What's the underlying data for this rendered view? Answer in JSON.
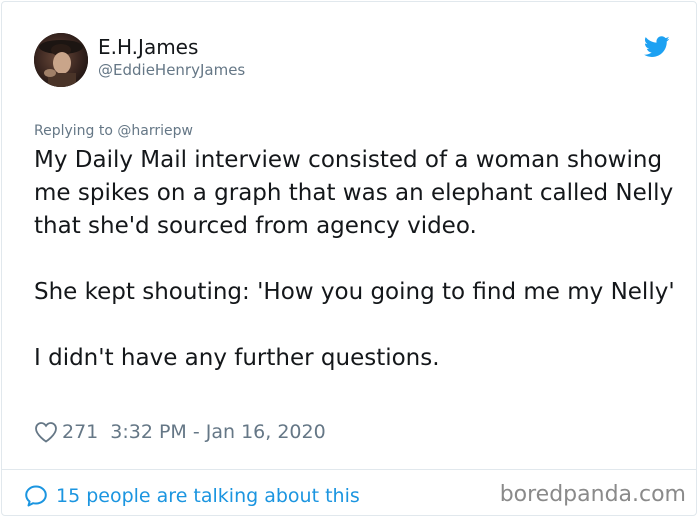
{
  "tweet": {
    "author": {
      "display_name": "E.H.James",
      "handle": "@EddieHenryJames"
    },
    "reply_to": "Replying to @harriepw",
    "paragraphs": [
      "My Daily Mail interview consisted of a woman showing me spikes on a graph that was an elephant called Nelly that she'd sourced from agency video.",
      "She kept shouting: 'How you going to find me my Nelly'",
      "I didn't have any further questions."
    ],
    "likes": "271",
    "timestamp": "3:32 PM - Jan 16, 2020"
  },
  "footer": {
    "conversation_link": "15 people are talking about this"
  },
  "watermark": "boredpanda.com",
  "icons": {
    "brand": "twitter-bird-icon",
    "like": "heart-icon",
    "conversation": "speech-bubble-icon"
  },
  "colors": {
    "twitter_blue": "#1da1f2",
    "link_blue": "#1b95e0",
    "secondary_text": "#657786",
    "primary_text": "#14171a",
    "border": "#e1e8ed",
    "watermark": "#8a8a8a"
  }
}
